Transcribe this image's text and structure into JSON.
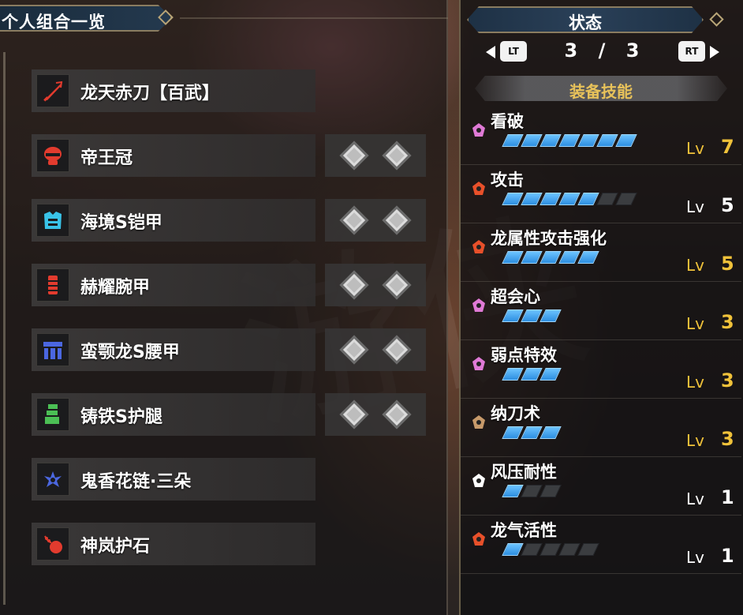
{
  "left_panel": {
    "title": "个人组合一览",
    "equipment": [
      {
        "name": "龙天赤刀【百武】",
        "icon": "sword-icon",
        "icon_color": "#e23b2e",
        "slots": 0
      },
      {
        "name": "帝王冠",
        "icon": "helmet-icon",
        "icon_color": "#e23b2e",
        "slots": 2
      },
      {
        "name": "海境S铠甲",
        "icon": "chest-armor-icon",
        "icon_color": "#39c3e8",
        "slots": 2
      },
      {
        "name": "赫耀腕甲",
        "icon": "arm-armor-icon",
        "icon_color": "#e23b2e",
        "slots": 2
      },
      {
        "name": "蛮颚龙S腰甲",
        "icon": "waist-armor-icon",
        "icon_color": "#4b67e0",
        "slots": 2
      },
      {
        "name": "铸铁S护腿",
        "icon": "leg-armor-icon",
        "icon_color": "#4bbf55",
        "slots": 2
      },
      {
        "name": "鬼香花链·三朵",
        "icon": "petalace-icon",
        "icon_color": "#4b67e0",
        "slots": 0
      },
      {
        "name": "神岚护石",
        "icon": "talisman-icon",
        "icon_color": "#e23b2e",
        "slots": 0
      }
    ]
  },
  "right_panel": {
    "title": "状态",
    "pager": {
      "left_button": "LT",
      "right_button": "RT",
      "current": "3",
      "separator": "/",
      "total": "3"
    },
    "section_title": "装备技能",
    "lv_label": "Lv",
    "skills": [
      {
        "name": "看破",
        "level": "7",
        "max": 7,
        "gem_color": "#e07ad6",
        "level_color": "#f0c23a"
      },
      {
        "name": "攻击",
        "level": "5",
        "max": 7,
        "gem_color": "#e8502a",
        "level_color": "#ffffff"
      },
      {
        "name": "龙属性攻击强化",
        "level": "5",
        "max": 5,
        "gem_color": "#e8502a",
        "level_color": "#f0c23a"
      },
      {
        "name": "超会心",
        "level": "3",
        "max": 3,
        "gem_color": "#e07ad6",
        "level_color": "#f0c23a"
      },
      {
        "name": "弱点特效",
        "level": "3",
        "max": 3,
        "gem_color": "#e07ad6",
        "level_color": "#f0c23a"
      },
      {
        "name": "纳刀术",
        "level": "3",
        "max": 3,
        "gem_color": "#c79a6a",
        "level_color": "#f0c23a"
      },
      {
        "name": "风压耐性",
        "level": "1",
        "max": 3,
        "gem_color": "#ffffff",
        "level_color": "#ffffff"
      },
      {
        "name": "龙气活性",
        "level": "1",
        "max": 5,
        "gem_color": "#e8502a",
        "level_color": "#ffffff"
      }
    ]
  },
  "watermark": "游侠"
}
